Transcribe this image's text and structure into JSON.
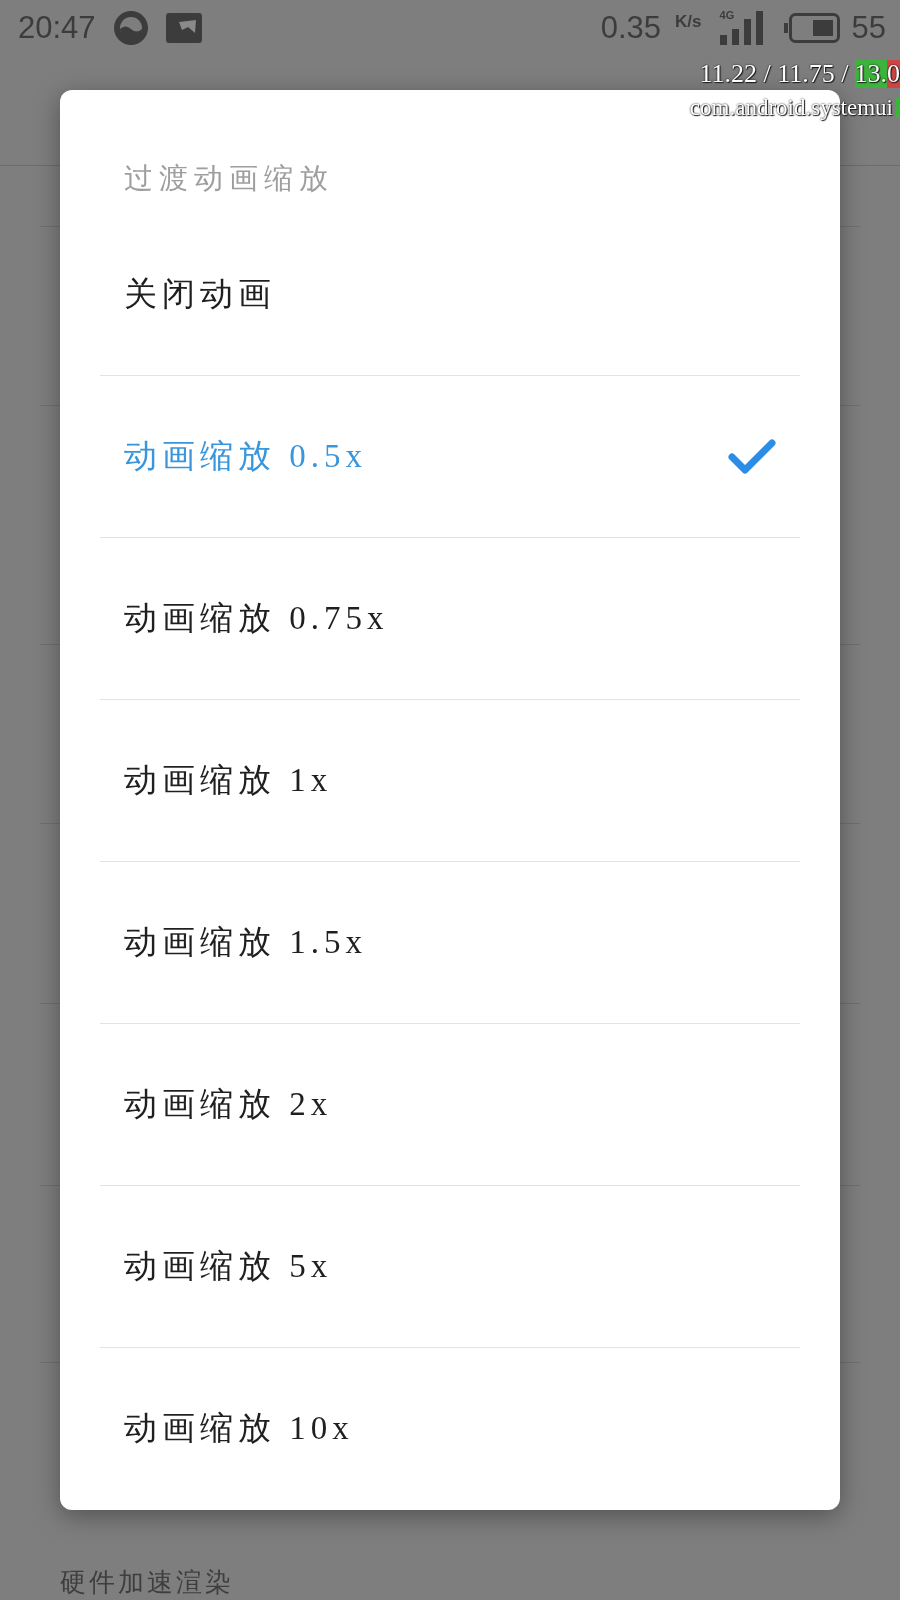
{
  "status_bar": {
    "time": "20:47",
    "net_speed": "0.35",
    "net_unit": "K/s",
    "network_type": "4G",
    "battery_text": "55"
  },
  "debug_overlay": {
    "frame_times": "11.22 / 11.75 /",
    "frame_segments": [
      {
        "text": "13.",
        "color": "#3cb43c"
      },
      {
        "text": "0",
        "color": "#cf4343"
      }
    ],
    "process": "com.android.systemui"
  },
  "dialog": {
    "title": "过渡动画缩放",
    "options": [
      {
        "label": "关闭动画",
        "selected": false
      },
      {
        "label": "动画缩放 0.5x",
        "selected": true
      },
      {
        "label": "动画缩放 0.75x",
        "selected": false
      },
      {
        "label": "动画缩放 1x",
        "selected": false
      },
      {
        "label": "动画缩放 1.5x",
        "selected": false
      },
      {
        "label": "动画缩放 2x",
        "selected": false
      },
      {
        "label": "动画缩放 5x",
        "selected": false
      },
      {
        "label": "动画缩放 10x",
        "selected": false
      }
    ]
  },
  "background": {
    "label": "硬件加速渲染"
  }
}
